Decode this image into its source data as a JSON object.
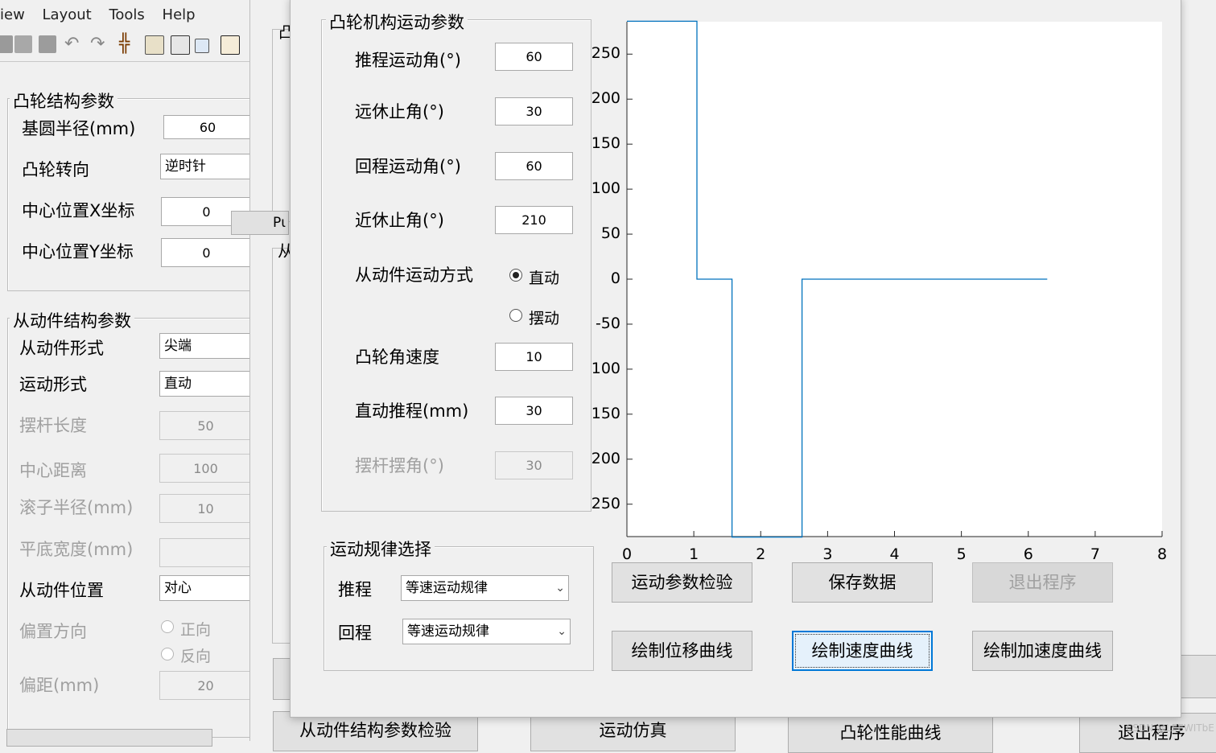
{
  "menu": [
    "iew",
    "Layout",
    "Tools",
    "Help"
  ],
  "cam_struct": {
    "title": "凸轮结构参数",
    "base_radius_label": "基圆半径(mm)",
    "base_radius_value": "60",
    "rotation_label": "凸轮转向",
    "rotation_value": "逆时针",
    "cx_label": "中心位置X坐标",
    "cx_value": "0",
    "cy_label": "中心位置Y坐标",
    "cy_value": "0"
  },
  "follower_struct": {
    "title": "从动件结构参数",
    "form_label": "从动件形式",
    "form_value": "尖端",
    "motion_label": "运动形式",
    "motion_value": "直动",
    "rod_len_label": "摆杆长度",
    "rod_len_value": "50",
    "center_dist_label": "中心距离",
    "center_dist_value": "100",
    "roller_label": "滚子半径(mm)",
    "roller_value": "10",
    "flat_label": "平底宽度(mm)",
    "flat_value": "",
    "position_label": "从动件位置",
    "position_value": "对心",
    "offset_dir_label": "偏置方向",
    "offset_pos": "正向",
    "offset_neg": "反向",
    "offset_label": "偏距(mm)",
    "offset_value": "20"
  },
  "middle": {
    "pu_fragment": "Pι",
    "frag_tu": "凸",
    "frag_cong": "从",
    "bottom_btn1": "从动件结构参数检验",
    "bottom_btn2": "运动仿真",
    "bottom_btn3": "凸轮性能曲线",
    "bottom_btn4": "退出程序",
    "watermark": "CSDN @LEEWITbE"
  },
  "motion_params": {
    "title": "凸轮机构运动参数",
    "push_angle_label": "推程运动角(°)",
    "push_angle_value": "60",
    "far_rest_label": "远休止角(°)",
    "far_rest_value": "30",
    "return_angle_label": "回程运动角(°)",
    "return_angle_value": "60",
    "near_rest_label": "近休止角(°)",
    "near_rest_value": "210",
    "follower_mode_label": "从动件运动方式",
    "mode_translate": "直动",
    "mode_swing": "摆动",
    "omega_label": "凸轮角速度",
    "omega_value": "10",
    "stroke_label": "直动推程(mm)",
    "stroke_value": "30",
    "swing_angle_label": "摆杆摆角(°)",
    "swing_angle_value": "30"
  },
  "law_select": {
    "title": "运动规律选择",
    "push_label": "推程",
    "push_value": "等速运动规律",
    "return_label": "回程",
    "return_value": "等速运动规律"
  },
  "buttons": {
    "check": "运动参数检验",
    "save": "保存数据",
    "exit": "退出程序",
    "disp": "绘制位移曲线",
    "vel": "绘制速度曲线",
    "acc": "绘制加速度曲线"
  },
  "chart_data": {
    "type": "line",
    "title": "",
    "xlabel": "",
    "ylabel": "",
    "xlim": [
      0,
      8
    ],
    "ylim": [
      -286,
      286
    ],
    "x_ticks": [
      "0",
      "1",
      "2",
      "3",
      "4",
      "5",
      "6",
      "7",
      "8"
    ],
    "y_ticks": [
      {
        "v": 250,
        "label": "250"
      },
      {
        "v": 200,
        "label": "200"
      },
      {
        "v": 150,
        "label": "150"
      },
      {
        "v": 100,
        "label": "100"
      },
      {
        "v": 50,
        "label": "50"
      },
      {
        "v": 0,
        "label": "0"
      },
      {
        "v": -50,
        "label": "-50"
      },
      {
        "v": -100,
        "label": "100"
      },
      {
        "v": -150,
        "label": "150"
      },
      {
        "v": -200,
        "label": "200"
      },
      {
        "v": -250,
        "label": "250"
      }
    ],
    "series": [
      {
        "color": "#0072bd",
        "x": [
          0,
          1.047,
          1.047,
          1.571,
          1.571,
          2.618,
          2.618,
          6.283
        ],
        "y": [
          286.5,
          286.5,
          0,
          0,
          -286.5,
          -286.5,
          0,
          0
        ]
      }
    ]
  }
}
